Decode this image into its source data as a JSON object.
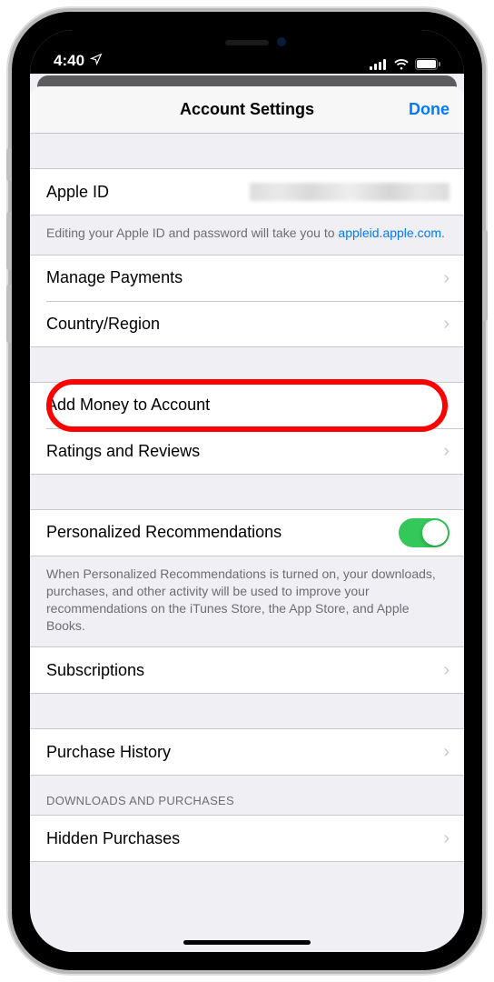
{
  "status": {
    "time": "4:40",
    "location_icon": "location-arrow",
    "signal": "signal-icon",
    "wifi": "wifi-icon",
    "battery": "battery-icon"
  },
  "nav": {
    "title": "Account Settings",
    "done": "Done"
  },
  "rows": {
    "apple_id_label": "Apple ID",
    "apple_id_hint_prefix": "Editing your Apple ID and password will take you to ",
    "apple_id_link": "appleid.apple.com",
    "apple_id_hint_suffix": ".",
    "manage_payments": "Manage Payments",
    "country_region": "Country/Region",
    "add_money": "Add Money to Account",
    "ratings_reviews": "Ratings and Reviews",
    "personalized": "Personalized Recommendations",
    "personalized_state": true,
    "personalized_hint": "When Personalized Recommendations is turned on, your downloads, purchases, and other activity will be used to improve your recommendations on the iTunes Store, the App Store, and Apple Books.",
    "subscriptions": "Subscriptions",
    "purchase_history": "Purchase History",
    "downloads_header": "DOWNLOADS AND PURCHASES",
    "hidden_purchases": "Hidden Purchases"
  },
  "colors": {
    "accent": "#007aff",
    "toggle_on": "#34c759",
    "highlight": "#ff0000"
  }
}
